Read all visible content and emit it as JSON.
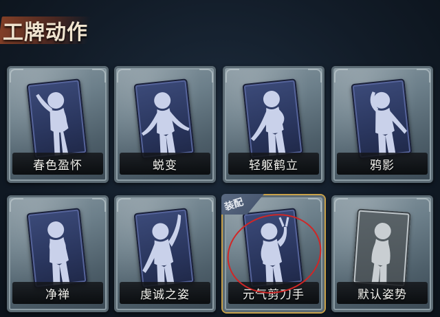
{
  "header": {
    "title": "工牌动作"
  },
  "cards": [
    {
      "id": "chunse",
      "label": "春色盈怀",
      "pose": "raise-hand",
      "equipped": false
    },
    {
      "id": "tuibian",
      "label": "蜕变",
      "pose": "arms-out",
      "equipped": false
    },
    {
      "id": "qingqu",
      "label": "轻躯鹤立",
      "pose": "hand-hip",
      "equipped": false
    },
    {
      "id": "yaying",
      "label": "鸦影",
      "pose": "hand-head",
      "equipped": false
    },
    {
      "id": "jingchan",
      "label": "净禅",
      "pose": "hands-chest",
      "equipped": false
    },
    {
      "id": "qiancheng",
      "label": "虔诚之姿",
      "pose": "arm-up",
      "equipped": false
    },
    {
      "id": "yuanqi",
      "label": "元气剪刀手",
      "pose": "peace-sign",
      "equipped": true,
      "equip_tag": "装配"
    },
    {
      "id": "moren",
      "label": "默认姿势",
      "pose": "default",
      "equipped": false
    }
  ],
  "colors": {
    "highlight_border": "#c9a24a",
    "annotation_circle": "#d02626"
  }
}
